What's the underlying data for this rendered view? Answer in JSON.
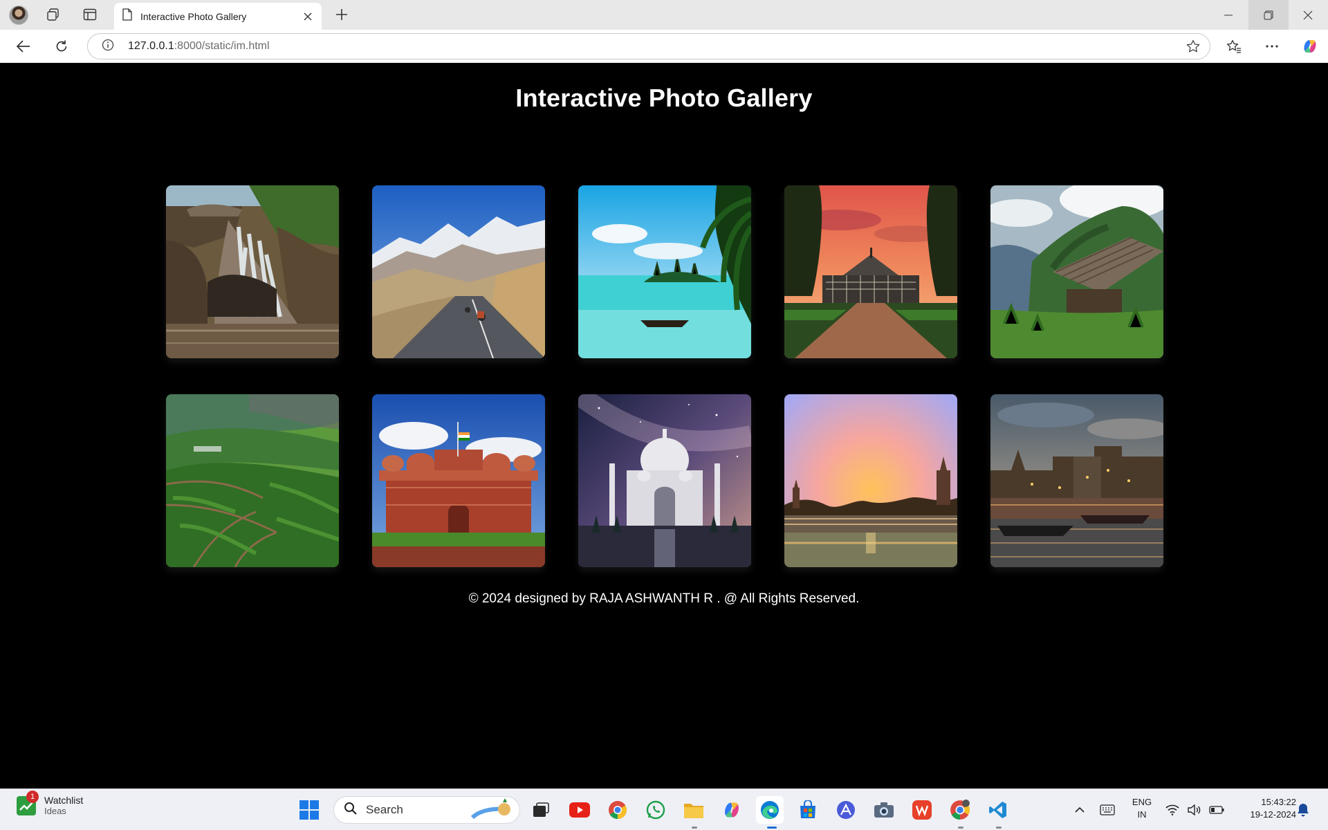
{
  "browser": {
    "tab_title": "Interactive Photo Gallery",
    "url_host": "127.0.0.1",
    "url_path": ":8000/static/im.html"
  },
  "page": {
    "title": "Interactive Photo Gallery",
    "footer": "© 2024 designed by RAJA ASHWANTH R . @ All Rights Reserved.",
    "photos": [
      {
        "name": "waterfall"
      },
      {
        "name": "mountain-road"
      },
      {
        "name": "tropical-island"
      },
      {
        "name": "glasshouse-sunset"
      },
      {
        "name": "mountain-hut"
      },
      {
        "name": "tea-plantation"
      },
      {
        "name": "red-fort"
      },
      {
        "name": "taj-mahal"
      },
      {
        "name": "temple-sunset"
      },
      {
        "name": "river-ghats"
      }
    ]
  },
  "taskbar": {
    "watchlist_title": "Watchlist",
    "watchlist_sub": "Ideas",
    "watchlist_badge": "1",
    "search_placeholder": "Search",
    "lang_top": "ENG",
    "lang_bottom": "IN",
    "time": "15:43:22",
    "date": "19-12-2024"
  }
}
